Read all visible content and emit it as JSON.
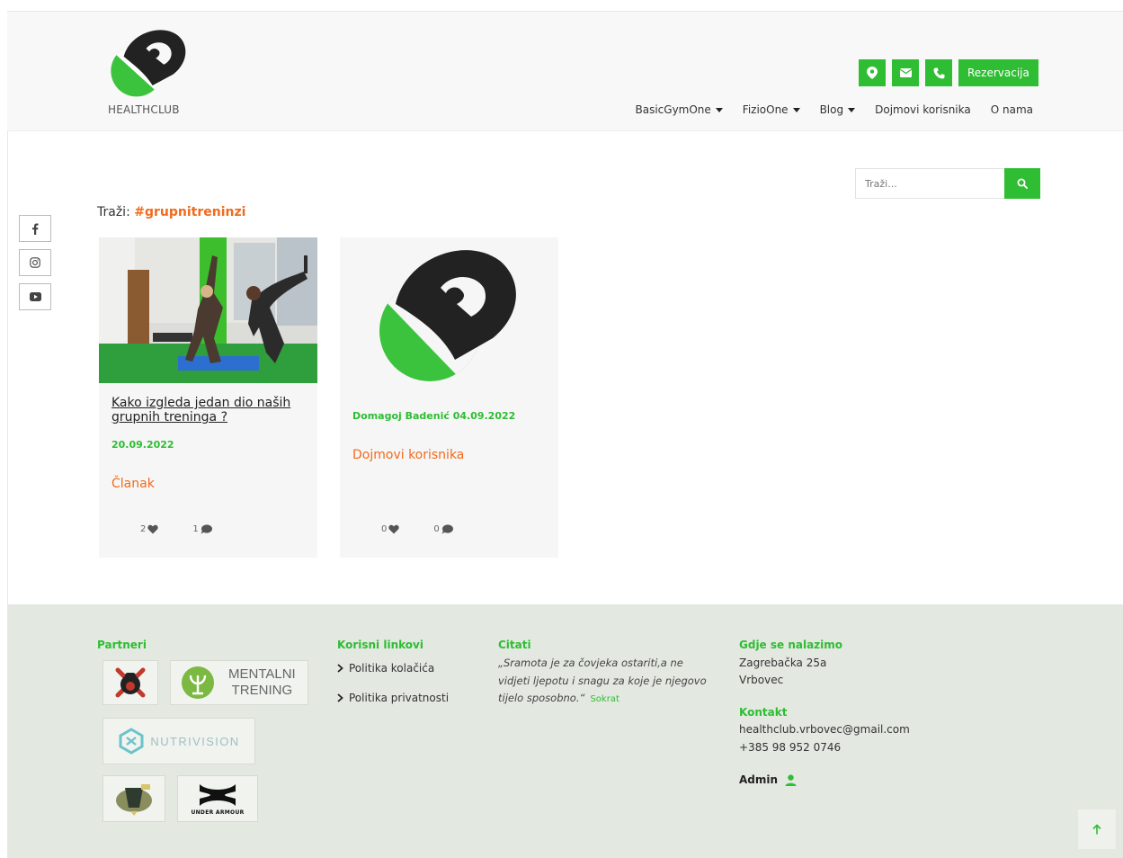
{
  "header": {
    "logo_text": "HEALTHCLUB",
    "reservation_label": "Rezervacija",
    "nav": [
      {
        "label": "BasicGymOne",
        "dropdown": true
      },
      {
        "label": "FizioOne",
        "dropdown": true
      },
      {
        "label": "Blog",
        "dropdown": true
      },
      {
        "label": "Dojmovi korisnika",
        "dropdown": false
      },
      {
        "label": "O nama",
        "dropdown": false
      }
    ]
  },
  "search": {
    "placeholder": "Traži...",
    "result_prefix": "Traži:",
    "result_tag": "#grupnitreninzi"
  },
  "posts": [
    {
      "title": "Kako izgleda jedan dio naših grupnih treninga ?",
      "date": "20.09.2022",
      "category": "Članak",
      "likes": "2",
      "comments": "1"
    },
    {
      "title": "",
      "date": "Domagoj Badenić 04.09.2022",
      "category": "Dojmovi korisnika",
      "likes": "0",
      "comments": "0"
    }
  ],
  "footer": {
    "partners_heading": "Partneri",
    "partners": [
      "MENTALNI",
      "TRENING",
      "NUTRIVISION",
      "UNDER ARMOUR"
    ],
    "links_heading": "Korisni linkovi",
    "links": [
      "Politika kolačića",
      "Politika privatnosti"
    ],
    "quotes_heading": "Citati",
    "quote_text": "„Sramota je za čovjeka ostariti,a ne vidjeti ljepotu i snagu za koje je njegovo tijelo sposobno.“",
    "quote_author": "Sokrat",
    "location_heading": "Gdje se nalazimo",
    "address_line1": "Zagrebačka 25a",
    "address_line2": "Vrbovec",
    "contact_heading": "Kontakt",
    "email": "healthclub.vrbovec@gmail.com",
    "phone": "+385 98 952 0746",
    "admin_label": "Admin"
  },
  "colors": {
    "brand_green": "#2ebd33",
    "accent_orange": "#f26a1b",
    "footer_bg": "#e3e8e1"
  }
}
